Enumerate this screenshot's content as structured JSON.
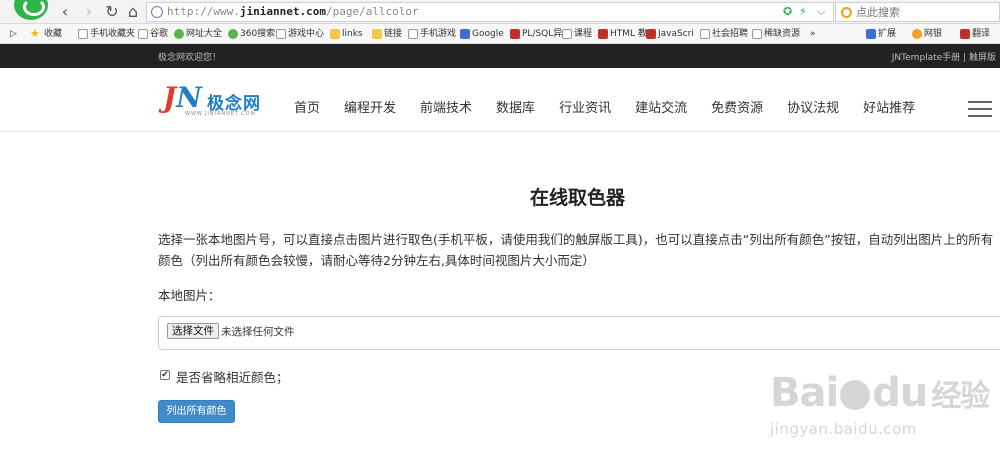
{
  "browser": {
    "url_prefix": "http://www.",
    "url_domain": "jiniannet.com",
    "url_path": "/page/allcolor",
    "search_placeholder": "点此搜索",
    "nav": {
      "back": "‹",
      "forward": "›",
      "refresh": "↻",
      "home": "⌂"
    }
  },
  "bookmarks": [
    {
      "label": "收藏",
      "icon": "star"
    },
    {
      "label": "手机收藏夹",
      "icon": "page"
    },
    {
      "label": "谷歌",
      "icon": "page"
    },
    {
      "label": "网址大全",
      "icon": "green"
    },
    {
      "label": "360搜索",
      "icon": "green"
    },
    {
      "label": "游戏中心",
      "icon": "page"
    },
    {
      "label": "links",
      "icon": "folder"
    },
    {
      "label": "链接",
      "icon": "folder"
    },
    {
      "label": "手机游戏",
      "icon": "page"
    },
    {
      "label": "Google",
      "icon": "blue"
    },
    {
      "label": "PL/SQL异",
      "icon": "red"
    },
    {
      "label": "课程",
      "icon": "page"
    },
    {
      "label": "HTML 教",
      "icon": "red"
    },
    {
      "label": "JavaScri",
      "icon": "red"
    },
    {
      "label": "社会招聘",
      "icon": "page"
    },
    {
      "label": "稀缺资源",
      "icon": "page"
    },
    {
      "label": "»",
      "icon": ""
    },
    {
      "label": "扩展",
      "icon": "blue"
    },
    {
      "label": "网银",
      "icon": "orange"
    },
    {
      "label": "翻译",
      "icon": "red"
    }
  ],
  "topbar": {
    "welcome": "极念网欢迎您！",
    "links": "JNTemplate手册 | 触屏版"
  },
  "logo": {
    "j": "J",
    "n": "N",
    "name": "极念网",
    "sub": "WWW.JINIANNET.COM"
  },
  "menu": [
    "首页",
    "编程开发",
    "前端技术",
    "数据库",
    "行业资讯",
    "建站交流",
    "免费资源",
    "协议法规",
    "好站推荐"
  ],
  "main": {
    "title": "在线取色器",
    "description": "选择一张本地图片号，可以直接点击图片进行取色(手机平板，请使用我们的触屏版工具)，也可以直接点击“列出所有颜色”按钮，自动列出图片上的所有颜色（列出所有颜色会较慢，请耐心等待2分钟左右,具体时间视图片大小而定）",
    "local_image_label": "本地图片：",
    "file_button": "选择文件",
    "file_status": "未选择任何文件",
    "omit_similar_label": "是否省略相近颜色；",
    "omit_similar_checked": true,
    "list_colors_button": "列出所有颜色"
  },
  "watermark": {
    "brand": "Bai",
    "brand_end": "du",
    "cn": "经验",
    "url": "jingyan.baidu.com"
  },
  "colors": {
    "topbar_bg": "#222222",
    "primary": "#428bca",
    "logo_red": "#e23b2c",
    "logo_blue": "#1e7fc8"
  }
}
